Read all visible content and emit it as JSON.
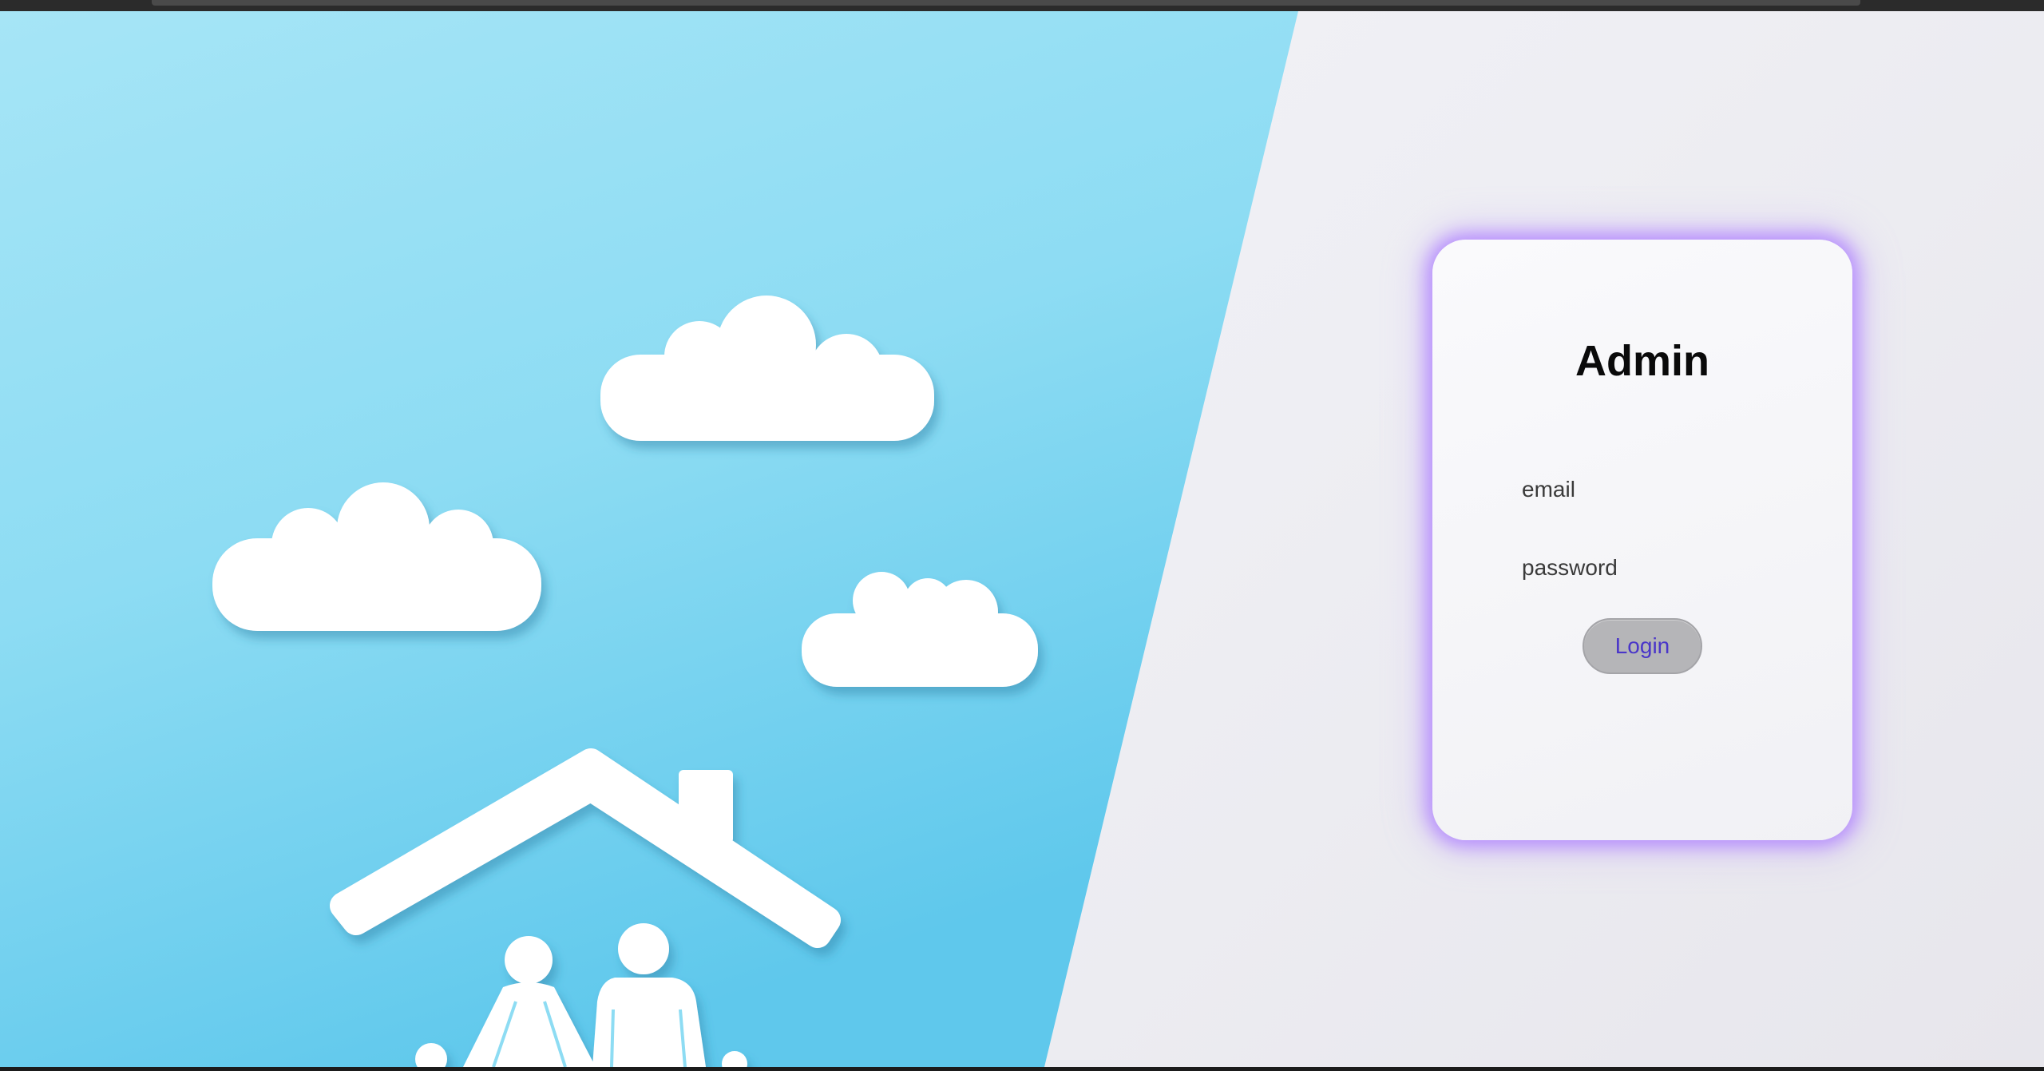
{
  "login_card": {
    "title": "Admin",
    "email_label": "email",
    "password_label": "password",
    "login_button_label": "Login"
  },
  "colors": {
    "hero_blue": "#8fdcf2",
    "card_glow": "#aa78ff",
    "button_bg": "#b5b5b8",
    "button_text": "#4a36c9"
  },
  "icons": {
    "hero_image": "clouds-house-family-illustration"
  }
}
